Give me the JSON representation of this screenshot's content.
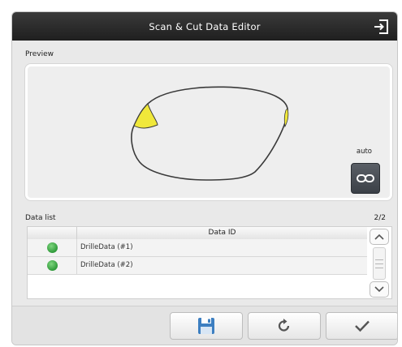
{
  "window": {
    "title": "Scan & Cut Data Editor",
    "exit_icon": "exit-icon"
  },
  "preview": {
    "label": "Preview",
    "auto_label": "auto",
    "link_icon": "link-icon"
  },
  "data_list": {
    "label": "Data list",
    "count": "2/2",
    "columns": [
      "",
      "Data ID"
    ],
    "rows": [
      {
        "status": "green",
        "id": "DrilleData (#1)"
      },
      {
        "status": "green",
        "id": "DrilleData (#2)"
      }
    ]
  },
  "actions": {
    "save_icon": "save-icon",
    "refresh_icon": "refresh-icon",
    "confirm_icon": "checkmark-icon"
  },
  "colors": {
    "titlebar": "#262626",
    "status_green": "#3aa845",
    "highlight_yellow": "#f0e83a",
    "save_blue": "#3d7fc1"
  }
}
